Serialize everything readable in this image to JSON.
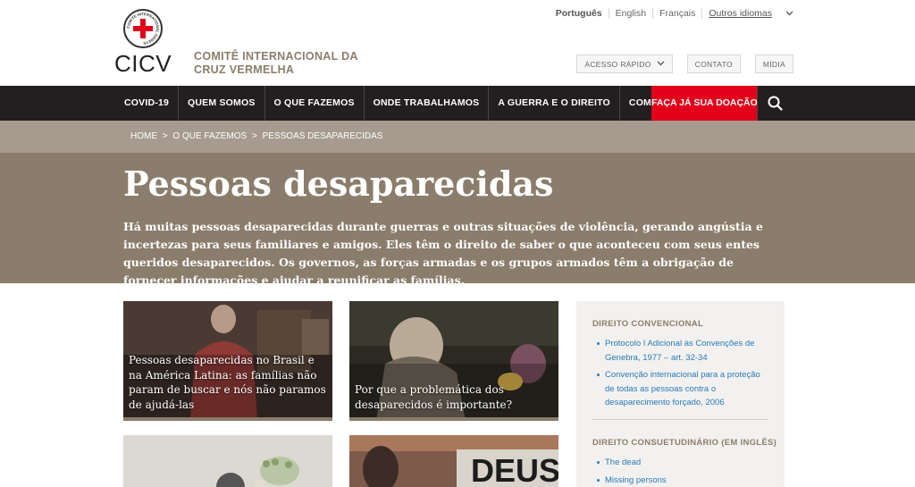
{
  "header": {
    "logo_text": "CICV",
    "emblem_text": "COMITE INTERNATIONAL GENEVE",
    "org_name_line1": "COMITÊ INTERNACIONAL DA",
    "org_name_line2": "CRUZ VERMELHA",
    "languages": [
      "Português",
      "English",
      "Français"
    ],
    "other_languages": "Outros idiomas",
    "quick_access": "ACESSO RÁPIDO",
    "contact": "CONTATO",
    "media": "MÍDIA"
  },
  "nav": {
    "items": [
      "COVID-19",
      "QUEM SOMOS",
      "O QUE FAZEMOS",
      "ONDE TRABALHAMOS",
      "A GUERRA E O DIREITO",
      "COMO AJUDAR"
    ],
    "donate": "FAÇA JÁ SUA DOAÇÃO",
    "search_icon": "search-icon"
  },
  "breadcrumb": {
    "items": [
      "HOME",
      "O QUE FAZEMOS",
      "PESSOAS DESAPARECIDAS"
    ],
    "separator": ">"
  },
  "hero": {
    "title": "Pessoas desaparecidas",
    "intro": "Há muitas pessoas desaparecidas durante guerras e outras situações de violência, gerando angústia e incertezas para seus familiares e amigos. Eles têm o direito de saber o que aconteceu com seus entes queridos desaparecidos. Os governos, as forças armadas e os grupos armados têm a obrigação de fornecer informações e ajudar a reunificar as famílias."
  },
  "cards": [
    {
      "caption": "Pessoas desaparecidas no Brasil e na América Latina: as famílias não param de buscar e nós não paramos de ajudá-las"
    },
    {
      "caption": "Por que a problemática dos desaparecidos é importante?"
    },
    {
      "caption": ""
    },
    {
      "caption": "",
      "image_text": "DEUS"
    }
  ],
  "sidebar": {
    "sections": [
      {
        "title": "DIREITO CONVENCIONAL",
        "links": [
          "Protocolo I Adicional às Convenções de Genebra, 1977 – art. 32-34",
          "Convenção internacional para a proteção de todas as pessoas contra o desaparecimento forçado, 2006"
        ]
      },
      {
        "title": "DIREITO CONSUETUDINÁRIO (EM INGLÊS)",
        "links": [
          "The dead",
          "Missing persons"
        ]
      }
    ]
  },
  "colors": {
    "brand_red": "#e2001a",
    "nav_bg": "#231f20",
    "hero_bg": "#8b7d6b",
    "breadcrumb_bg": "#a69b8e",
    "link_blue": "#2a7ab8"
  }
}
